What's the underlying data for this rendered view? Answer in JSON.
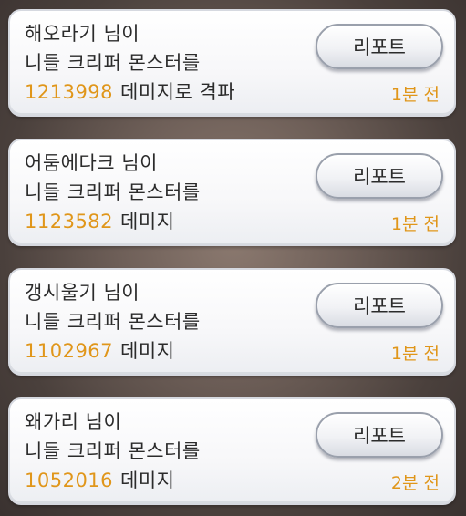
{
  "notifications": [
    {
      "player": "해오라기 님이",
      "message": "니들 크리퍼 몬스터를",
      "damage": "1213998",
      "result": "데미지로 격파",
      "report_label": "리포트",
      "time": "1분 전"
    },
    {
      "player": "어둠에다크 님이",
      "message": "니들 크리퍼 몬스터를",
      "damage": "1123582",
      "result": "데미지",
      "report_label": "리포트",
      "time": "1분 전"
    },
    {
      "player": "갱시울기 님이",
      "message": "니들 크리퍼 몬스터를",
      "damage": "1102967",
      "result": "데미지",
      "report_label": "리포트",
      "time": "1분 전"
    },
    {
      "player": "왜가리 님이",
      "message": "니들 크리퍼 몬스터를",
      "damage": "1052016",
      "result": "데미지",
      "report_label": "리포트",
      "time": "2분 전"
    }
  ]
}
